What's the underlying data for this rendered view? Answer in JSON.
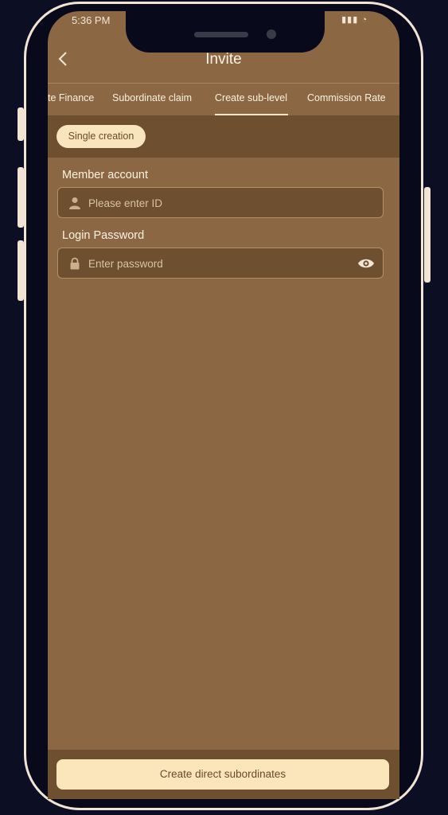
{
  "status_bar": {
    "time": "5:36 PM",
    "icons": "▮▮▮ ◔"
  },
  "header": {
    "back_icon": "chevron-left-icon",
    "title": "Invite"
  },
  "tabs": [
    {
      "label": "te Finance",
      "active": false
    },
    {
      "label": "Subordinate claim",
      "active": false
    },
    {
      "label": "Create sub-level",
      "active": true
    },
    {
      "label": "Commission Rate",
      "active": false
    }
  ],
  "subtab": {
    "label": "Single creation"
  },
  "form": {
    "member_account": {
      "label": "Member account",
      "placeholder": "Please enter ID",
      "icon": "user-icon"
    },
    "login_password": {
      "label": "Login Password",
      "placeholder": "Enter password",
      "icon": "lock-icon",
      "toggle_icon": "eye-icon"
    }
  },
  "submit": {
    "label": "Create direct subordinates"
  },
  "colors": {
    "background": "#8b6843",
    "panel": "#6e4f30",
    "accent": "#f8e5bd",
    "frame": "#f2e3d3"
  }
}
